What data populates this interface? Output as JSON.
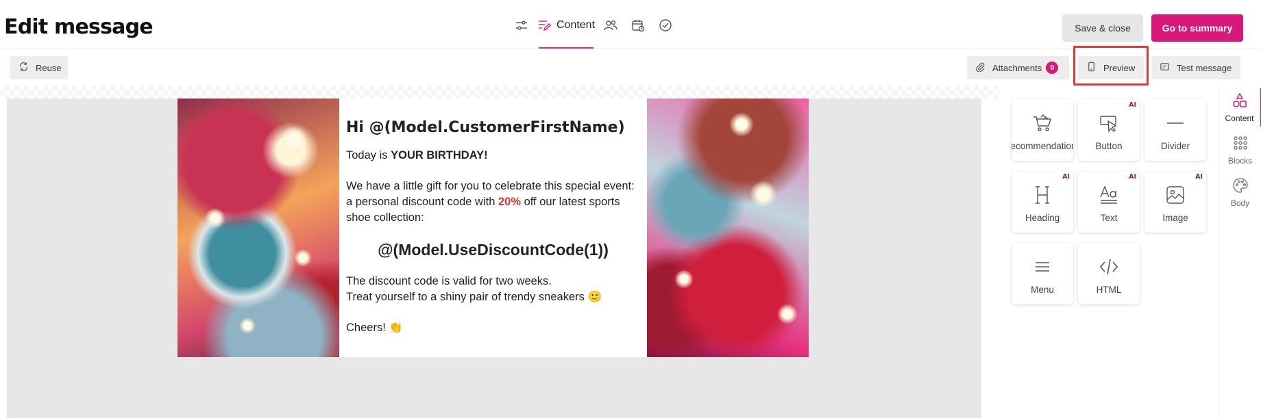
{
  "header": {
    "title": "Edit message",
    "steps": [
      {
        "icon": "sliders-icon",
        "label": ""
      },
      {
        "icon": "content-icon",
        "label": "Content",
        "active": true
      },
      {
        "icon": "people-icon",
        "label": ""
      },
      {
        "icon": "calendar-icon",
        "label": ""
      },
      {
        "icon": "check-circle-icon",
        "label": ""
      }
    ],
    "save_close_label": "Save & close",
    "summary_label": "Go to summary"
  },
  "toolbar": {
    "reuse_label": "Reuse",
    "attachments_label": "Attachments",
    "attachments_count": "0",
    "preview_label": "Preview",
    "test_message_label": "Test message"
  },
  "email": {
    "greeting": "Hi @(Model.CustomerFirstName)",
    "birthday_prefix": "Today is ",
    "birthday_strong": "YOUR BIRTHDAY!",
    "gift_text_1": "We have a little gift for you to celebrate this special event: a personal discount code with ",
    "gift_percent": "20%",
    "gift_text_2": " off our latest sports shoe collection:",
    "discount_code": "@(Model.UseDiscountCode(1))",
    "valid_text": "The discount code is valid for two weeks.",
    "treat_text": "Treat yourself to a shiny pair of trendy sneakers 🙂",
    "cheers_text": "Cheers! 👏"
  },
  "content_blocks": [
    {
      "label": "Recommendations",
      "icon": "cart-icon",
      "ai": false
    },
    {
      "label": "Button",
      "icon": "cursor-button-icon",
      "ai": true
    },
    {
      "label": "Divider",
      "icon": "divider-icon",
      "ai": false
    },
    {
      "label": "Heading",
      "icon": "heading-icon",
      "ai": true
    },
    {
      "label": "Text",
      "icon": "text-icon",
      "ai": true
    },
    {
      "label": "Image",
      "icon": "image-icon",
      "ai": true
    },
    {
      "label": "Menu",
      "icon": "menu-icon",
      "ai": false
    },
    {
      "label": "HTML",
      "icon": "code-icon",
      "ai": false
    }
  ],
  "ai_badge": "AI",
  "side_tabs": [
    {
      "label": "Content",
      "icon": "shapes-icon",
      "active": true
    },
    {
      "label": "Blocks",
      "icon": "grid-dots-icon",
      "active": false
    },
    {
      "label": "Body",
      "icon": "palette-icon",
      "active": false
    }
  ],
  "colors": {
    "accent": "#d8197a",
    "highlight": "#e53935",
    "discount": "#e5322d"
  }
}
